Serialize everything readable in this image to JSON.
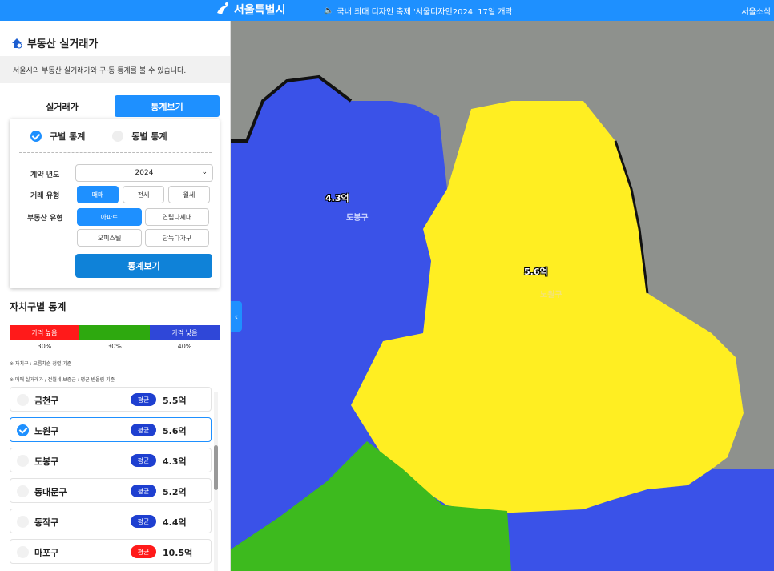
{
  "topbar": {
    "logo_text": "서울특별시",
    "notice": "국내 최대 디자인 축제 '서울디자인2024' 17일 개막",
    "right_text": "서울소식",
    "brand_color": "#1e90ff"
  },
  "sidebar": {
    "title": "부동산 실거래가",
    "description": "서울시의 부동산 실거래가와 구·동 통계를 볼 수 있습니다.",
    "tabs": [
      {
        "label": "실거래가",
        "active": false
      },
      {
        "label": "통계보기",
        "active": true
      }
    ],
    "radio": [
      {
        "label": "구별 통계",
        "checked": true
      },
      {
        "label": "동별 통계",
        "checked": false
      }
    ],
    "fields": {
      "year_label": "계약 년도",
      "year_value": "2024",
      "trade_label": "거래 유형",
      "trade_options": [
        {
          "label": "매매",
          "selected": true
        },
        {
          "label": "전세",
          "selected": false
        },
        {
          "label": "월세",
          "selected": false
        }
      ],
      "property_label": "부동산 유형",
      "property_options": [
        {
          "label": "아파트",
          "selected": true
        },
        {
          "label": "연립다세대",
          "selected": false
        },
        {
          "label": "오피스텔",
          "selected": false
        },
        {
          "label": "단독다가구",
          "selected": false
        }
      ]
    },
    "submit_label": "통계보기",
    "section_title": "자치구별 통계",
    "legend": [
      {
        "label": "가격 높음",
        "pct": "30%",
        "color": "#ff1a1a"
      },
      {
        "label": "",
        "pct": "30%",
        "color": "#2ea90f"
      },
      {
        "label": "가격 낮음",
        "pct": "40%",
        "color": "#2f47d8"
      }
    ],
    "notes": [
      "※ 자치구 : 오름차순 정렬 기준",
      "※ 매매 실거래가 / 전월세 보증금 : 평균 반올림 기준"
    ],
    "districts": [
      {
        "name": "금천구",
        "badge": "평균",
        "price": "5.5억",
        "badge_color": "#1e3fd0",
        "selected": false
      },
      {
        "name": "노원구",
        "badge": "평균",
        "price": "5.6억",
        "badge_color": "#1e3fd0",
        "selected": true
      },
      {
        "name": "도봉구",
        "badge": "평균",
        "price": "4.3억",
        "badge_color": "#1e3fd0",
        "selected": false
      },
      {
        "name": "동대문구",
        "badge": "평균",
        "price": "5.2억",
        "badge_color": "#1e3fd0",
        "selected": false
      },
      {
        "name": "동작구",
        "badge": "평균",
        "price": "4.4억",
        "badge_color": "#1e3fd0",
        "selected": false
      },
      {
        "name": "마포구",
        "badge": "평균",
        "price": "10.5억",
        "badge_color": "#ff1a1a",
        "selected": false
      }
    ]
  },
  "map": {
    "labels": [
      {
        "text": "4.3억",
        "district": "도봉구"
      },
      {
        "text": "5.6억",
        "district": "노원구"
      }
    ],
    "district_names": [
      "도봉구",
      "노원구"
    ],
    "colors": {
      "low": "#3a52e8",
      "mid": "#3dba1e",
      "high_selected": "#ffee22"
    }
  }
}
